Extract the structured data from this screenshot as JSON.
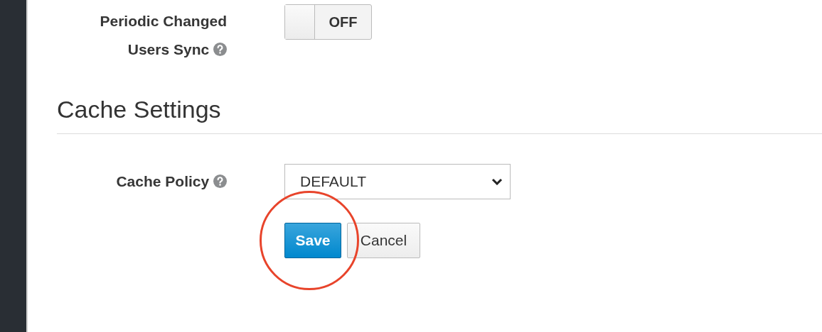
{
  "periodic_sync": {
    "label": "Periodic Changed Users Sync",
    "on": false,
    "state_text": "OFF"
  },
  "section": {
    "title": "Cache Settings"
  },
  "cache_policy": {
    "label": "Cache Policy",
    "value": "DEFAULT"
  },
  "buttons": [
    {
      "label": "Save",
      "kind": "primary"
    },
    {
      "label": "Cancel",
      "kind": "default"
    }
  ]
}
